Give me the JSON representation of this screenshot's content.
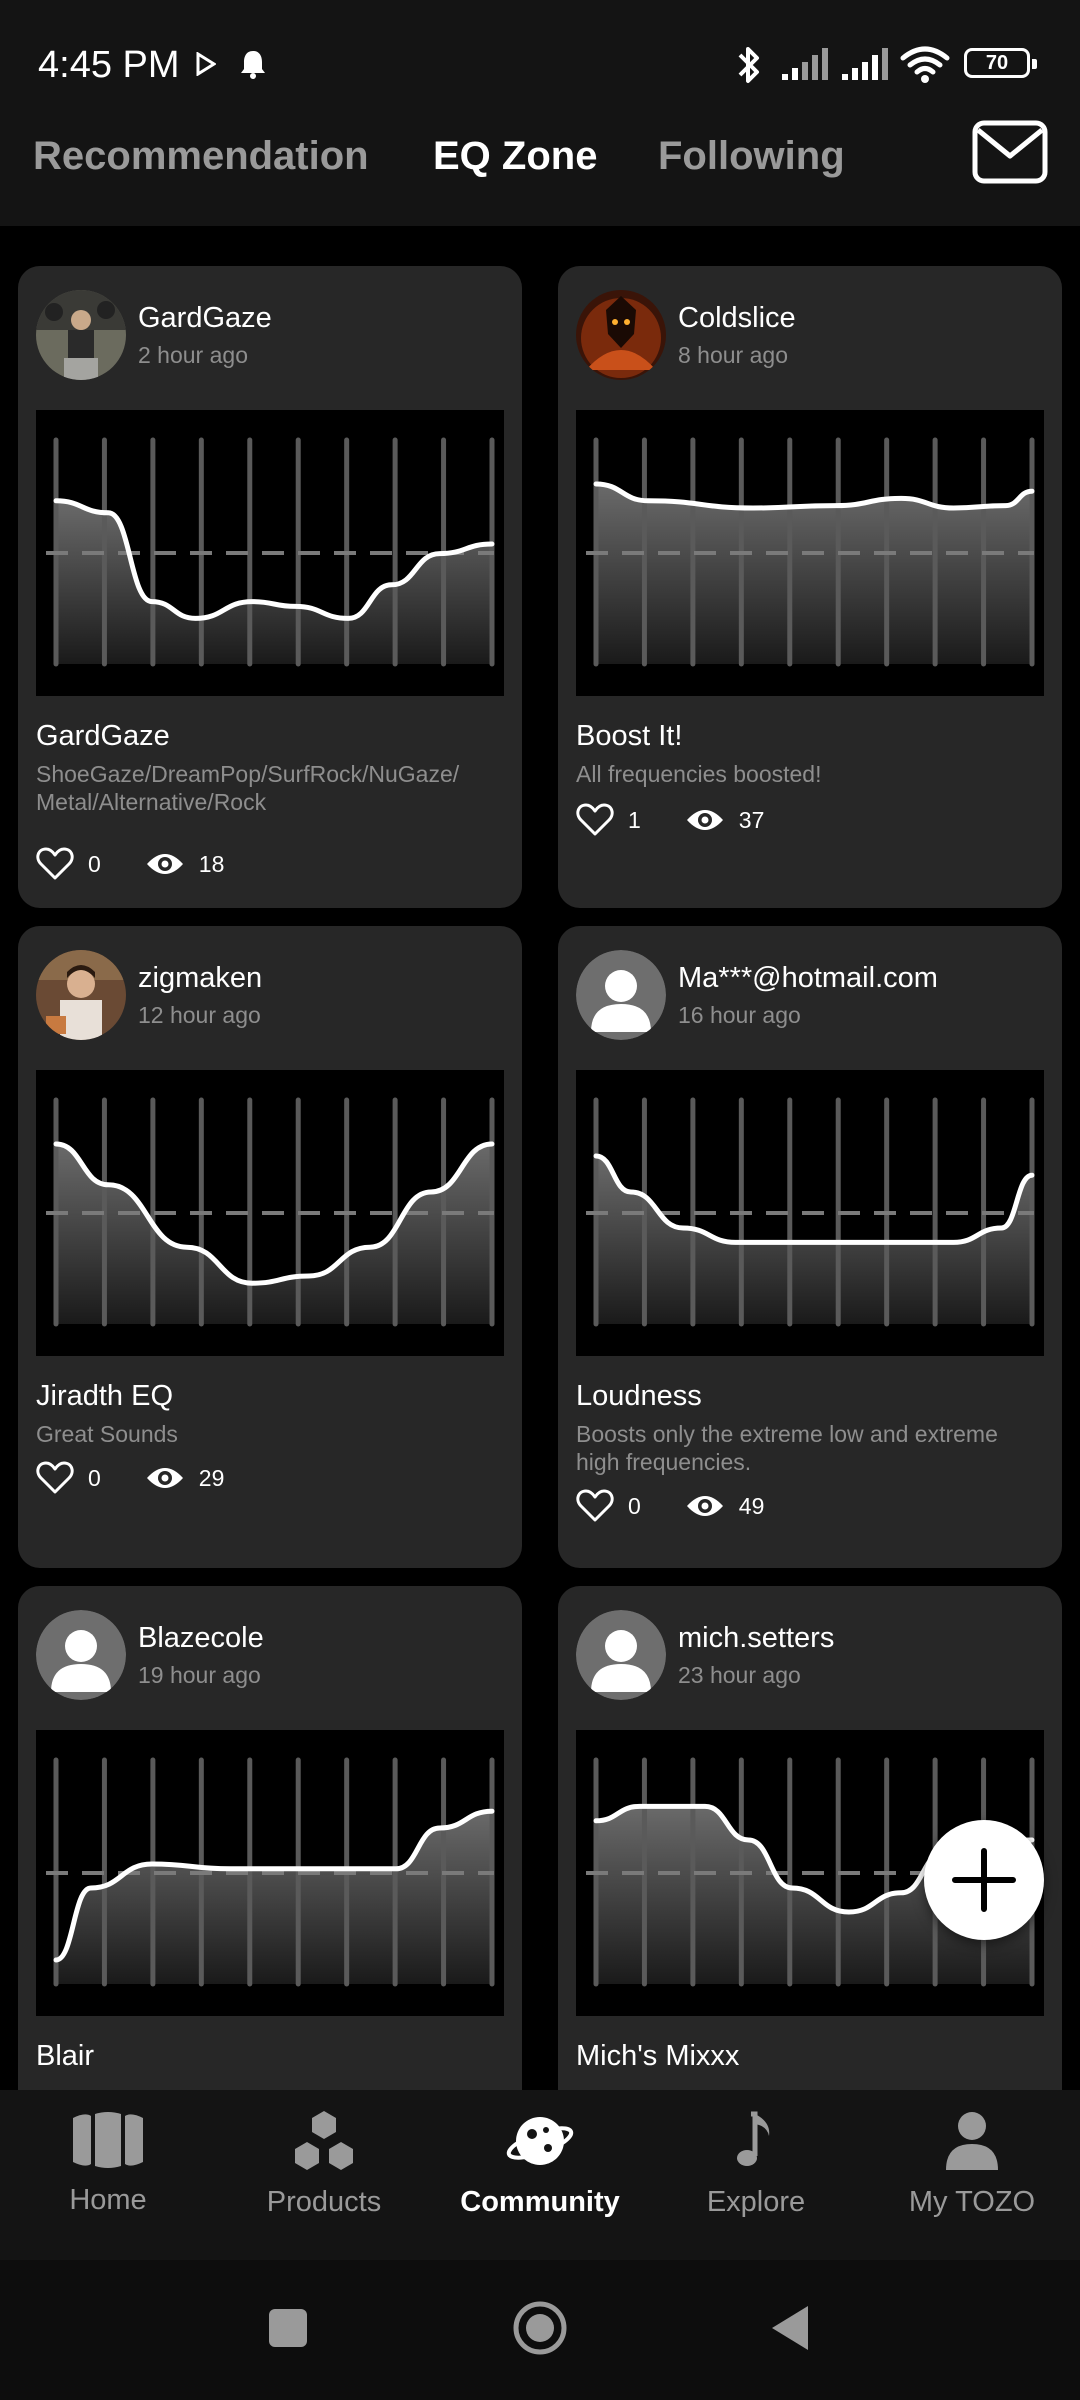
{
  "status_bar": {
    "time": "4:45 PM",
    "battery": "70"
  },
  "top_tabs": [
    "Recommendation",
    "EQ Zone",
    "Following"
  ],
  "cards": [
    {
      "user": "GardGaze",
      "time": "2 hour ago",
      "title": "GardGaze",
      "description": "ShoeGaze/DreamPop/SurfRock/NuGaze/ Metal/Alternative/Rock",
      "likes": "0",
      "views": "18"
    },
    {
      "user": "Coldslice",
      "time": "8 hour ago",
      "title": "Boost It!",
      "description": "All frequencies boosted!",
      "likes": "1",
      "views": "37"
    },
    {
      "user": "zigmaken",
      "time": "12 hour ago",
      "title": "Jiradth EQ",
      "description": "Great Sounds",
      "likes": "0",
      "views": "29"
    },
    {
      "user": "Ma***@hotmail.com",
      "time": "16 hour ago",
      "title": "Loudness",
      "description": "Boosts only the extreme low and extreme high frequencies.",
      "likes": "0",
      "views": "49"
    },
    {
      "user": "Blazecole",
      "time": "19 hour ago",
      "title": "Blair",
      "description": "",
      "likes": "",
      "views": ""
    },
    {
      "user": "mich.setters",
      "time": "23 hour ago",
      "title": "Mich's Mixxx",
      "description": "",
      "likes": "",
      "views": ""
    }
  ],
  "bottom_nav": [
    "Home",
    "Products",
    "Community",
    "Explore",
    "My TOZO"
  ],
  "colors": {
    "background": "#000000",
    "card": "#272727",
    "bar": "#141414",
    "muted": "#8e8e8e"
  }
}
